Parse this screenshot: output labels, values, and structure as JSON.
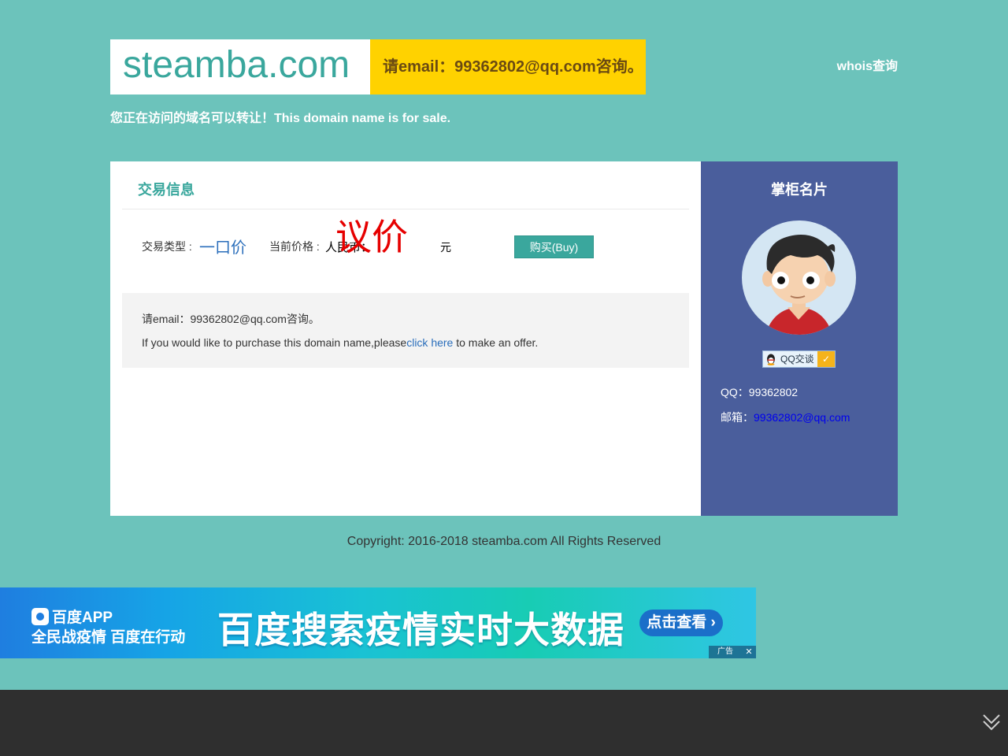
{
  "header": {
    "domain": "steamba.com",
    "contact": "请email：99362802@qq.com咨询。",
    "whois_label": "whois查询",
    "sale_note": "您正在访问的域名可以转让！This domain name is for sale."
  },
  "trade": {
    "title": "交易信息",
    "type_label": "交易类型 :",
    "type_value": "一口价",
    "price_label": "当前价格 :",
    "currency": "人民币：",
    "price_value": "议价",
    "unit": "元",
    "buy_label": "购买(Buy)"
  },
  "offer": {
    "line1": "请email：99362802@qq.com咨询。",
    "line2_prefix": "If you would like to purchase this domain name,please",
    "line2_link": "click here",
    "line2_suffix": " to make an offer."
  },
  "owner": {
    "title": "掌柜名片",
    "qq_button_label": "QQ交谈",
    "qq_label": "QQ：",
    "qq_value": "99362802",
    "email_label": "邮箱：",
    "email_value": "99362802@qq.com"
  },
  "copyright": "Copyright: 2016-2018 steamba.com All Rights Reserved",
  "ad": {
    "app_name": "百度APP",
    "slogan": "全民战疫情 百度在行动",
    "headline": "百度搜索疫情实时大数据",
    "cta": "点击查看",
    "badge": "广告",
    "close": "✕"
  },
  "icons": {
    "avatar": "cartoon-boy-avatar-icon",
    "qq": "qq-penguin-icon",
    "expand": "double-chevron-down-icon"
  }
}
